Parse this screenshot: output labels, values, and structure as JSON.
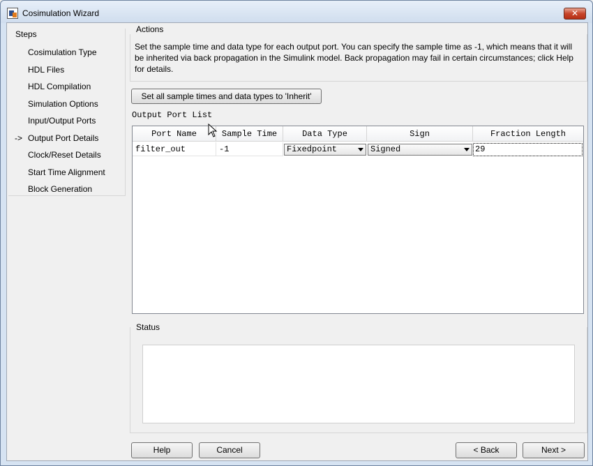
{
  "window": {
    "title": "Cosimulation Wizard",
    "close_label": "✕"
  },
  "steps": {
    "title": "Steps",
    "current_marker": "->",
    "items": [
      "Cosimulation Type",
      "HDL Files",
      "HDL Compilation",
      "Simulation Options",
      "Input/Output Ports",
      "Output Port Details",
      "Clock/Reset Details",
      "Start Time Alignment",
      "Block Generation"
    ],
    "current_index": 5
  },
  "actions": {
    "title": "Actions",
    "description": "Set the sample time and data type for each output port. You can specify the sample time as -1, which means that it will be inherited via back propagation in the Simulink model. Back propagation may fail in certain circumstances; click Help for details.",
    "set_all_button": "Set all sample times and data types to 'Inherit'"
  },
  "port_list": {
    "label": "Output Port List",
    "columns": [
      "Port Name",
      "Sample Time",
      "Data Type",
      "Sign",
      "Fraction Length"
    ],
    "rows": [
      {
        "port_name": "filter_out",
        "sample_time": "-1",
        "data_type": "Fixedpoint",
        "sign": "Signed",
        "fraction_length": "29"
      }
    ]
  },
  "status": {
    "title": "Status",
    "text": ""
  },
  "buttons": {
    "help": "Help",
    "cancel": "Cancel",
    "back": "< Back",
    "next": "Next >"
  }
}
